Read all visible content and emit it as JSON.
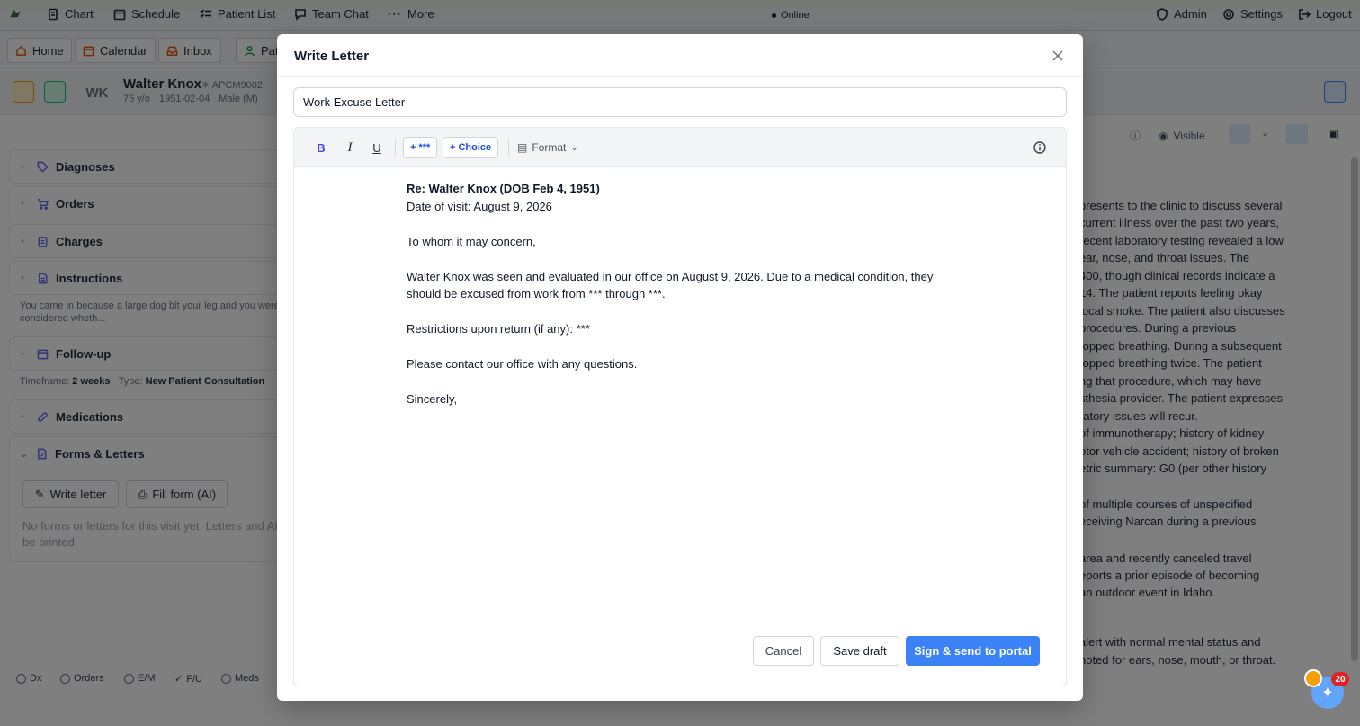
{
  "nav": {
    "chart": "Chart",
    "schedule": "Schedule",
    "patient_list": "Patient List",
    "team_chat": "Team Chat",
    "more": "More",
    "status": "Online",
    "admin": "Admin",
    "settings": "Settings",
    "logout": "Logout"
  },
  "tabs": {
    "home": "Home",
    "calendar": "Calendar",
    "inbox": "Inbox",
    "patient": "Pat"
  },
  "patient": {
    "initials": "WK",
    "name": "Walter Knox",
    "id": "APCM9002",
    "age": "75 y/o",
    "dob": "1951-02-04",
    "sex": "Male (M)"
  },
  "toolbar_right": {
    "visible": "Visible"
  },
  "sections": {
    "diagnoses": "Diagnoses",
    "orders": "Orders",
    "charges": "Charges",
    "instructions": "Instructions",
    "instructions_text": "You came in because a large dog bit your leg and you were",
    "instructions_text2": "considered wheth...",
    "followup": "Follow-up",
    "timeframe_label": "Timeframe:",
    "timeframe_value": "2 weeks",
    "type_label": "Type:",
    "type_value": "New Patient Consultation",
    "medications": "Medications",
    "forms": "Forms & Letters",
    "write_letter": "Write letter",
    "fill_form": "Fill form (AI)",
    "no_forms": "No forms or letters for this visit yet. Letters and AI",
    "no_forms2": "be printed."
  },
  "right_text": [
    "presents to the clinic to discuss several",
    "current illness over the past two years,",
    "recent laboratory testing revealed a low",
    "ear, nose, and throat issues. The",
    "400, though clinical records indicate a",
    "14. The patient reports feeling okay",
    "local smoke. The patient also discusses",
    "procedures. During a previous",
    "topped breathing. During a subsequent",
    "topped breathing twice. The patient",
    "ng that procedure, which may have",
    "sthesia provider. The patient expresses",
    "ratory issues will recur.",
    "of immunotherapy; history of kidney",
    "otor vehicle accident; history of broken",
    "etric summary: G0 (per other history",
    "",
    "of multiple courses of unspecified",
    "eceiving Narcan during a previous",
    "",
    "area and recently canceled travel",
    "eports a prior episode of becoming",
    "an outdoor event in Idaho.",
    "",
    "",
    "alert with normal mental status and",
    "noted for ears, nose, mouth, or throat."
  ],
  "bottom": {
    "dx": "Dx",
    "orders": "Orders",
    "em": "E/M",
    "fu": "F/U",
    "meds": "Meds"
  },
  "modal": {
    "title": "Write Letter",
    "subject": "Work Excuse Letter",
    "insert_placeholder": "+ ***",
    "insert_choice": "+ Choice",
    "format": "Format",
    "letter": {
      "re": "Re: Walter Knox (DOB Feb 4, 1951)",
      "date": "Date of visit: August 9, 2026",
      "greeting": "To whom it may concern,",
      "body1": "Walter Knox was seen and evaluated in our office on August 9, 2026. Due to a medical condition, they",
      "body2": "should be excused from work from *** through ***.",
      "restrictions": "Restrictions upon return (if any): ***",
      "contact": "Please contact our office with any questions.",
      "closing": "Sincerely,"
    },
    "cancel": "Cancel",
    "save_draft": "Save draft",
    "sign_send": "Sign & send to portal"
  },
  "notifications": {
    "badge": "20"
  },
  "colors": {
    "primary": "#3b82f6",
    "accent_orange": "#ea580c",
    "icon_indigo": "#6366f1"
  }
}
